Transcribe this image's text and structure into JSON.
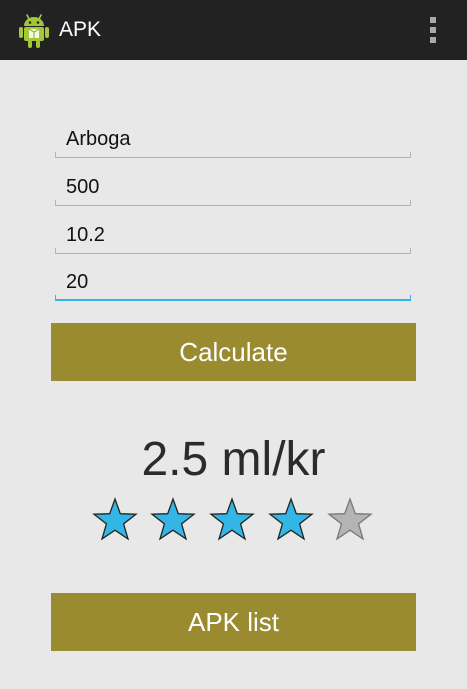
{
  "action_bar": {
    "title": "APK",
    "app_icon": "android-robot-icon",
    "menu_icon": "overflow-menu-icon"
  },
  "form": {
    "fields": [
      {
        "name": "store-field",
        "value": "Arboga",
        "focused": false
      },
      {
        "name": "volume-field",
        "value": "500",
        "focused": false
      },
      {
        "name": "alcohol-field",
        "value": "10.2",
        "focused": false
      },
      {
        "name": "price-field",
        "value": "20",
        "focused": true
      }
    ],
    "calculate_label": "Calculate"
  },
  "result": {
    "text": "2.5 ml/kr",
    "rating": 4,
    "rating_max": 5,
    "star_color_filled": "#33b5e5",
    "star_color_empty": "#b4b4b4"
  },
  "apk_list_label": "APK list",
  "colors": {
    "action_bar": "#222222",
    "background": "#e8e8e8",
    "button": "#9a8b30",
    "focus_accent": "#33b5e5",
    "android_green": "#a4c639"
  }
}
